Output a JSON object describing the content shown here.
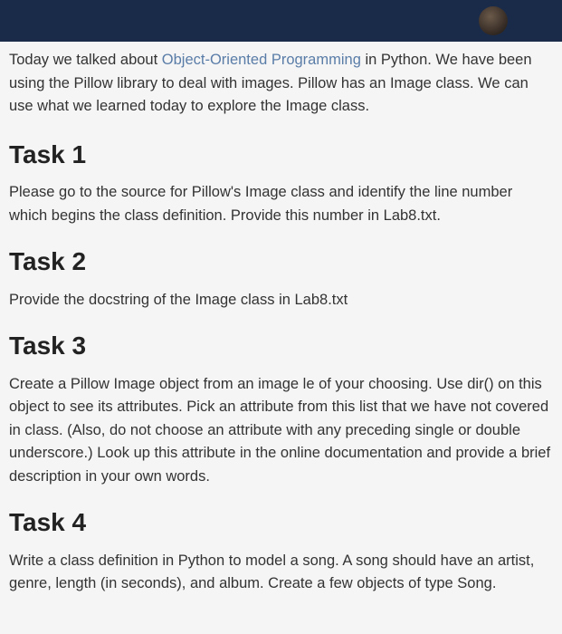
{
  "intro": {
    "prefix": "Today we talked about ",
    "link_text": "Object-Oriented Programming",
    "suffix": " in Python. We have been using the Pillow library to deal with images. Pillow has an Image class. We can use what we learned today to explore the Image class."
  },
  "tasks": [
    {
      "heading": "Task 1",
      "body": "Please go to the source for Pillow's Image class and identify the line number which begins the class definition. Provide this number in Lab8.txt."
    },
    {
      "heading": "Task 2",
      "body": "Provide the docstring of the Image class in Lab8.txt"
    },
    {
      "heading": "Task 3",
      "body": "Create a Pillow Image object from an image le of your choosing. Use dir() on this object to see its attributes. Pick an attribute from this list that we have not covered in class. (Also, do not choose an attribute with any preceding single or double underscore.) Look up this attribute in the online documentation and provide a brief description in your own words."
    },
    {
      "heading": "Task 4",
      "body": "Write a class definition in Python to model a song. A song should have an artist, genre, length (in seconds), and album. Create a few objects of type Song."
    }
  ]
}
